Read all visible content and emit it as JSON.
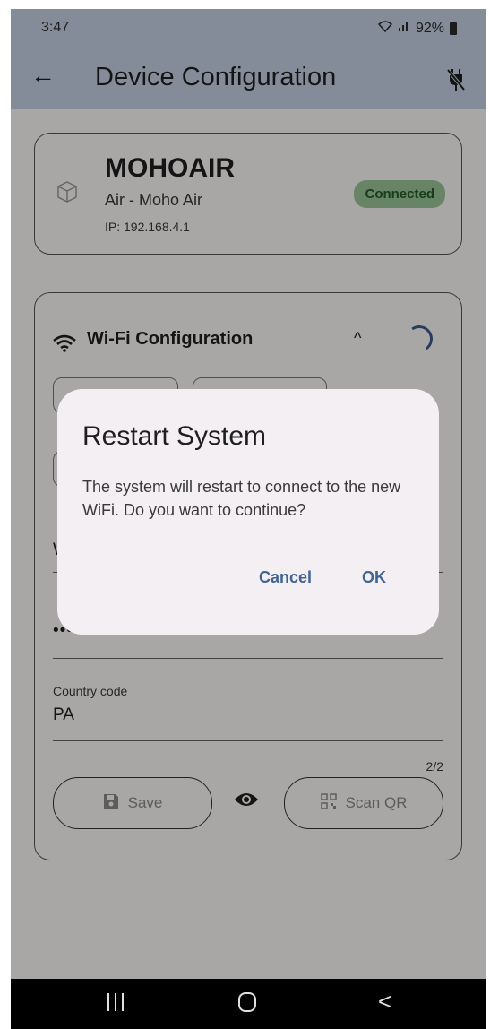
{
  "status_bar": {
    "time": "3:47",
    "battery": "92%"
  },
  "app_bar": {
    "title": "Device Configuration"
  },
  "device": {
    "name": "MOHOAIR",
    "type": "Air - Moho Air",
    "ip": "IP: 192.168.4.1",
    "status": "Connected"
  },
  "wifi": {
    "title": "Wi-Fi Configuration",
    "ssid_value": "W",
    "password_value": "••••••••",
    "country_label": "Country code",
    "country_value": "PA",
    "counter": "2/2",
    "save_label": "Save",
    "scan_label": "Scan QR"
  },
  "dialog": {
    "title": "Restart System",
    "message": "The system will restart to connect to the new WiFi. Do you want to continue?",
    "cancel": "Cancel",
    "ok": "OK"
  },
  "colors": {
    "app_bar_bg": "#c5d1e4",
    "accent": "#3f6496",
    "badge_bg": "#9cc59a",
    "badge_text": "#245b25"
  }
}
